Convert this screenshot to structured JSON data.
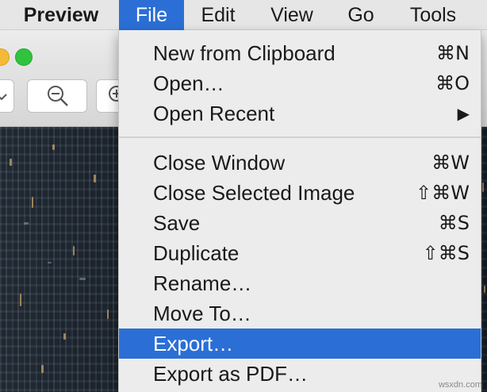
{
  "menubar": {
    "app_name": "Preview",
    "items": [
      "File",
      "Edit",
      "View",
      "Go",
      "Tools"
    ],
    "active_item": "File"
  },
  "file_menu": {
    "group1": [
      {
        "label": "New from Clipboard",
        "shortcut": "⌘N"
      },
      {
        "label": "Open…",
        "shortcut": "⌘O"
      },
      {
        "label": "Open Recent",
        "shortcut": "▶"
      }
    ],
    "group2": [
      {
        "label": "Close Window",
        "shortcut": "⌘W"
      },
      {
        "label": "Close Selected Image",
        "shortcut": "⇧⌘W"
      },
      {
        "label": "Save",
        "shortcut": "⌘S"
      },
      {
        "label": "Duplicate",
        "shortcut": "⇧⌘S"
      },
      {
        "label": "Rename…",
        "shortcut": ""
      },
      {
        "label": "Move To…",
        "shortcut": ""
      },
      {
        "label": "Export…",
        "shortcut": ""
      },
      {
        "label": "Export as PDF…",
        "shortcut": ""
      }
    ],
    "highlighted_item": "Export…"
  },
  "watermark": "wsxdn.com",
  "colors": {
    "menu_highlight": "#2b6fd6",
    "menu_background": "#ececec",
    "menubar_background": "#e6e6e6",
    "traffic_green": "#2fc33e",
    "traffic_yellow": "#f5b935"
  },
  "icons": [
    "zoom-out-icon",
    "zoom-in-icon",
    "chevron-down-icon",
    "submenu-arrow-icon"
  ]
}
